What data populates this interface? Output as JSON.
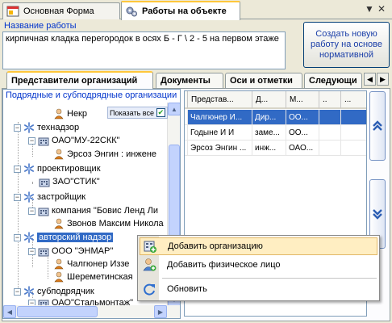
{
  "doc_tabs": [
    {
      "label": "Основная Форма"
    },
    {
      "label": "Работы на объекте"
    }
  ],
  "work_name": {
    "label": "Название работы",
    "value": "кирпичная кладка перегородок в осях Б - Г \\ 2 - 5 на первом этаже"
  },
  "create_button_label": "Создать новую работу на основе нормативной",
  "section_tabs": [
    "Представители организаций",
    "Документы",
    "Оси и отметки",
    "Следующи"
  ],
  "tree": {
    "header": "Подрядные и субподрядные организации",
    "show_all_label": "Показать все",
    "items": [
      {
        "label": "Некр"
      },
      {
        "label": "технадзор"
      },
      {
        "label": "ОАО\"МУ-22СКК\""
      },
      {
        "label": "Эрсоз Энгин : инжене"
      },
      {
        "label": "проектировщик"
      },
      {
        "label": "ЗАО\"СТИК\""
      },
      {
        "label": "застройщик"
      },
      {
        "label": "компания \"Бовис Ленд Ли"
      },
      {
        "label": "Звонов Максим Никола"
      },
      {
        "label": "авторский надзор"
      },
      {
        "label": "ООО \"ЭНМАР\""
      },
      {
        "label": "Чалгюнер Иззе"
      },
      {
        "label": "Шереметинская"
      },
      {
        "label": "субподрядчик"
      },
      {
        "label": "ОАО\"Стальмонтаж\""
      }
    ]
  },
  "grid": {
    "columns": [
      "Представ...",
      "Д...",
      "М...",
      "..",
      "..."
    ],
    "rows": [
      [
        "Чалгюнер И...",
        "Дир...",
        "ОО...",
        "",
        ""
      ],
      [
        "Годыне И И",
        "заме...",
        "ОО...",
        "",
        ""
      ],
      [
        "Эрсоз Энгин ...",
        "инж...",
        "ОАО...",
        "",
        ""
      ]
    ]
  },
  "context_menu": {
    "items": [
      {
        "label": "Добавить организацию"
      },
      {
        "label": "Добавить физическое лицо"
      },
      {
        "label": "Обновить"
      }
    ]
  },
  "colors": {
    "selection": "#316ac5",
    "menu_highlight": "#ffeec2",
    "link_blue": "#0033cc",
    "tab_accent": "#ffc73c"
  }
}
